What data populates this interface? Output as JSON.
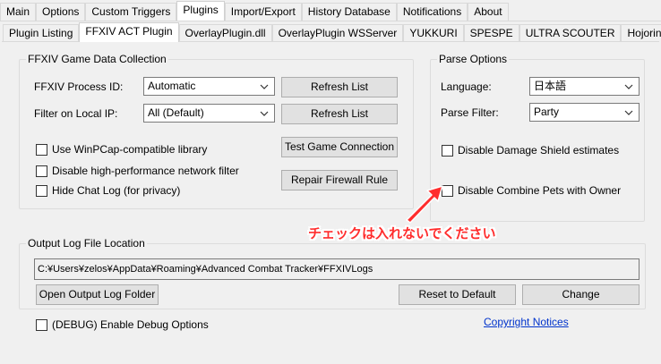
{
  "top_tabs": [
    "Main",
    "Options",
    "Custom Triggers",
    "Plugins",
    "Import/Export",
    "History Database",
    "Notifications",
    "About"
  ],
  "plugin_tabs": [
    "Plugin Listing",
    "FFXIV ACT Plugin",
    "OverlayPlugin.dll",
    "OverlayPlugin WSServer",
    "YUKKURI",
    "SPESPE",
    "ULTRA SCOUTER",
    "Hojoring"
  ],
  "game_data": {
    "legend": "FFXIV Game Data Collection",
    "process_id_label": "FFXIV Process ID:",
    "process_id_value": "Automatic",
    "filter_ip_label": "Filter on Local IP:",
    "filter_ip_value": "All (Default)",
    "refresh_label": "Refresh List",
    "test_connection_label": "Test Game Connection",
    "repair_firewall_label": "Repair Firewall Rule",
    "winpcap_label": "Use WinPCap-compatible library",
    "disable_filter_label": "Disable high-performance network filter",
    "hide_chat_label": "Hide Chat Log (for privacy)"
  },
  "parse_options": {
    "legend": "Parse Options",
    "language_label": "Language:",
    "language_value": "日本語",
    "parse_filter_label": "Parse Filter:",
    "parse_filter_value": "Party",
    "damage_shield_label": "Disable Damage Shield estimates",
    "combine_pets_label": "Disable Combine Pets with Owner"
  },
  "output_log": {
    "legend": "Output Log File Location",
    "path": "C:¥Users¥zelos¥AppData¥Roaming¥Advanced Combat Tracker¥FFXIVLogs",
    "open_folder_label": "Open Output Log Folder",
    "reset_label": "Reset to Default",
    "change_label": "Change"
  },
  "debug_label": "(DEBUG) Enable Debug Options",
  "copyright_label": "Copyright Notices",
  "annotation": "チェックは入れないでください",
  "colors": {
    "annotation": "#ff2d2d",
    "link": "#0033cc"
  }
}
